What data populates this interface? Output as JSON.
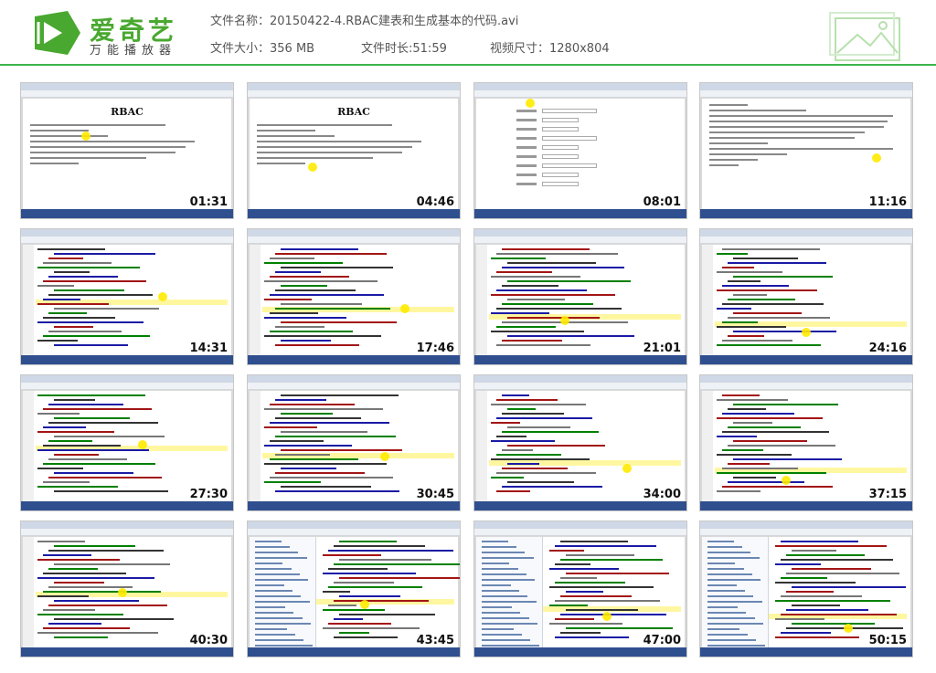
{
  "app": {
    "logo_text": "爱奇艺",
    "logo_subtitle": "万能播放器"
  },
  "file_info": {
    "name_label": "文件名称：",
    "name_value": "20150422-4.RBAC建表和生成基本的代码.avi",
    "size_label": "文件大小：",
    "size_value": "356 MB",
    "duration_label": "文件时长:",
    "duration_value": "51:59",
    "dimensions_label": "视频尺寸：",
    "dimensions_value": "1280x804"
  },
  "colors": {
    "brand_green": "#49a82f",
    "header_line": "#3cb44b"
  },
  "thumbnails": [
    {
      "timestamp": "01:31",
      "kind": "doc",
      "doc_title": "RBAC"
    },
    {
      "timestamp": "04:46",
      "kind": "doc",
      "doc_title": "RBAC"
    },
    {
      "timestamp": "08:01",
      "kind": "form"
    },
    {
      "timestamp": "11:16",
      "kind": "text"
    },
    {
      "timestamp": "14:31",
      "kind": "code"
    },
    {
      "timestamp": "17:46",
      "kind": "code"
    },
    {
      "timestamp": "21:01",
      "kind": "code"
    },
    {
      "timestamp": "24:16",
      "kind": "code"
    },
    {
      "timestamp": "27:30",
      "kind": "code"
    },
    {
      "timestamp": "30:45",
      "kind": "code"
    },
    {
      "timestamp": "34:00",
      "kind": "code"
    },
    {
      "timestamp": "37:15",
      "kind": "code"
    },
    {
      "timestamp": "40:30",
      "kind": "code"
    },
    {
      "timestamp": "43:45",
      "kind": "ide"
    },
    {
      "timestamp": "47:00",
      "kind": "ide"
    },
    {
      "timestamp": "50:15",
      "kind": "ide"
    }
  ]
}
